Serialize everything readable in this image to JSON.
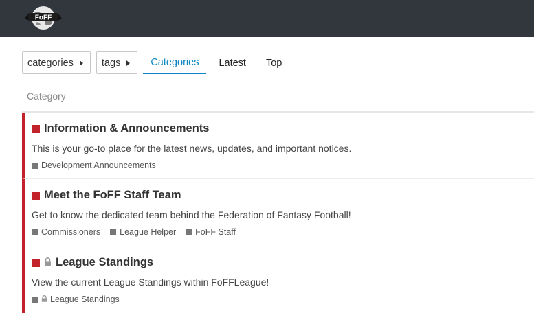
{
  "header": {
    "logo_text": "FoFF",
    "logo_icon": "football-globe-logo",
    "background": "#32363d"
  },
  "nav": {
    "categories_dropdown": "categories",
    "tags_dropdown": "tags",
    "tabs": [
      {
        "label": "Categories",
        "active": true
      },
      {
        "label": "Latest",
        "active": false
      },
      {
        "label": "Top",
        "active": false
      }
    ],
    "active_color": "#0a84c3"
  },
  "list": {
    "column_header": "Category",
    "accent_color": "#c3222a",
    "categories": [
      {
        "title": "Information & Announcements",
        "locked": false,
        "description": "This is your go-to place for the latest news, updates, and important notices.",
        "subcategories": [
          {
            "name": "Development Announcements",
            "locked": false
          }
        ]
      },
      {
        "title": "Meet the FoFF Staff Team",
        "locked": false,
        "description": "Get to know the dedicated team behind the Federation of Fantasy Football!",
        "subcategories": [
          {
            "name": "Commissioners",
            "locked": false
          },
          {
            "name": "League Helper",
            "locked": false
          },
          {
            "name": "FoFF Staff",
            "locked": false
          }
        ]
      },
      {
        "title": "League Standings",
        "locked": true,
        "description": "View the current League Standings within FoFFLeague!",
        "subcategories": [
          {
            "name": "League Standings",
            "locked": true
          }
        ]
      }
    ]
  }
}
